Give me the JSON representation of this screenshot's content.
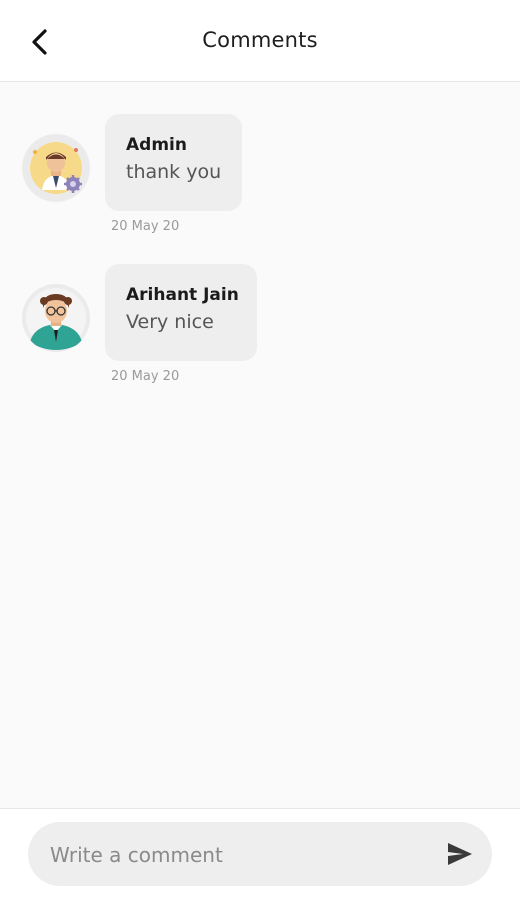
{
  "header": {
    "title": "Comments",
    "back_icon": "chevron-left-icon"
  },
  "comments": [
    {
      "author": "Admin",
      "text": "thank you",
      "date": "20 May 20",
      "avatar_icon": "admin-avatar-icon"
    },
    {
      "author": "Arihant Jain",
      "text": "Very nice",
      "date": "20 May 20",
      "avatar_icon": "user-avatar-icon"
    }
  ],
  "composer": {
    "placeholder": "Write a comment",
    "value": "",
    "send_icon": "send-icon"
  },
  "colors": {
    "background": "#fafafa",
    "bubble": "#eeeeee",
    "header": "#ffffff"
  }
}
